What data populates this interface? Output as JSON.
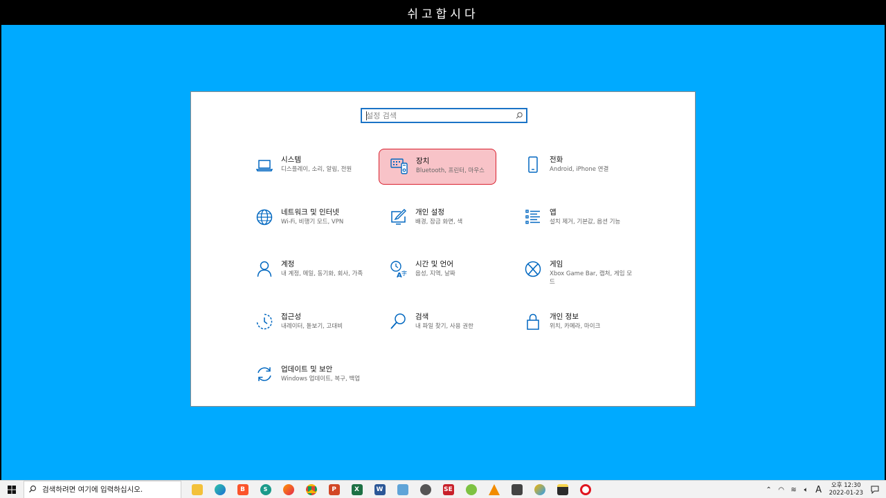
{
  "title_bar": {
    "text": "쉬고합시다"
  },
  "search": {
    "placeholder": "설정 검색"
  },
  "items": [
    {
      "title": "시스템",
      "desc": "디스플레이, 소리, 알림, 전원",
      "icon": "laptop-icon"
    },
    {
      "title": "장치",
      "desc": "Bluetooth, 프린터, 마우스",
      "icon": "devices-icon",
      "highlighted": true
    },
    {
      "title": "전화",
      "desc": "Android, iPhone 연결",
      "icon": "phone-icon"
    },
    {
      "title": "네트워크 및 인터넷",
      "desc": "Wi-Fi, 비행기 모드, VPN",
      "icon": "globe-icon"
    },
    {
      "title": "개인 설정",
      "desc": "배경, 잠금 화면, 색",
      "icon": "personalization-icon"
    },
    {
      "title": "앱",
      "desc": "설치 제거, 기본값, 옵션 기능",
      "icon": "apps-list-icon"
    },
    {
      "title": "계정",
      "desc": "내 계정, 메일, 동기화, 회사, 가족",
      "icon": "person-icon"
    },
    {
      "title": "시간 및 언어",
      "desc": "음성, 지역, 날짜",
      "icon": "time-language-icon"
    },
    {
      "title": "게임",
      "desc": "Xbox Game Bar, 캡처, 게임 모드",
      "icon": "xbox-icon"
    },
    {
      "title": "접근성",
      "desc": "내레이터, 돋보기, 고대비",
      "icon": "accessibility-icon"
    },
    {
      "title": "검색",
      "desc": "내 파일 찾기, 사용 권한",
      "icon": "search-icon"
    },
    {
      "title": "개인 정보",
      "desc": "위치, 카메라, 마이크",
      "icon": "lock-icon"
    },
    {
      "title": "업데이트 및 보안",
      "desc": "Windows 업데이트, 복구, 백업",
      "icon": "update-icon"
    }
  ],
  "taskbar": {
    "search_placeholder": "검색하려면 여기에 입력하십시오.",
    "time": "오후 12:30",
    "date": "2022-01-23",
    "ime": "A"
  },
  "colors": {
    "accent": "#0067c0",
    "desktop": "#00aaff",
    "highlight_bg": "#f8c3c8",
    "highlight_border": "#d8202e"
  }
}
